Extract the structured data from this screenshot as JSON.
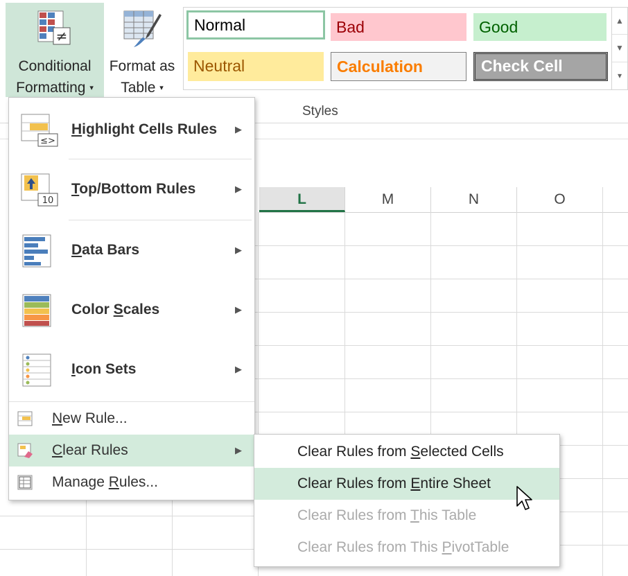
{
  "ribbon": {
    "conditional_formatting": {
      "line1": "Conditional",
      "line2": "Formatting",
      "arrow": "▾"
    },
    "format_as_table": {
      "line1": "Format as",
      "line2": "Table",
      "arrow": "▾"
    },
    "styles": [
      {
        "label": "Normal"
      },
      {
        "label": "Bad"
      },
      {
        "label": "Good"
      },
      {
        "label": "Neutral"
      },
      {
        "label": "Calculation"
      },
      {
        "label": "Check Cell"
      }
    ],
    "styles_group_label": "Styles",
    "scroll_up": "▲",
    "scroll_down": "▼",
    "scroll_more": "▾"
  },
  "sheet": {
    "columns": [
      "L",
      "M",
      "N",
      "O"
    ]
  },
  "menu": {
    "highlight_cells_rules": {
      "pre": "",
      "u": "H",
      "post": "ighlight Cells Rules"
    },
    "top_bottom_rules": {
      "pre": "",
      "u": "T",
      "post": "op/Bottom Rules"
    },
    "data_bars": {
      "pre": "",
      "u": "D",
      "post": "ata Bars"
    },
    "color_scales": {
      "pre": "Color ",
      "u": "S",
      "post": "cales"
    },
    "icon_sets": {
      "pre": "",
      "u": "I",
      "post": "con Sets"
    },
    "new_rule": {
      "pre": "",
      "u": "N",
      "post": "ew Rule..."
    },
    "clear_rules": {
      "pre": "",
      "u": "C",
      "post": "lear Rules"
    },
    "manage_rules": {
      "pre": "Manage ",
      "u": "R",
      "post": "ules..."
    },
    "submenu_arrow": "▶",
    "icons": {
      "highlight": "highlight-cells-icon",
      "top_bottom": "top-bottom-icon",
      "data_bars": "data-bars-icon",
      "color_scales": "color-scales-icon",
      "icon_sets": "icon-sets-icon",
      "new_rule": "new-rule-icon",
      "clear_rules": "clear-rules-icon",
      "manage_rules": "manage-rules-icon"
    },
    "highlight_icon_text": "≤>",
    "top_bottom_icon_text": "10",
    "cf_icon_text": "≠"
  },
  "submenu": {
    "items": [
      {
        "pre": "Clear Rules from ",
        "u": "S",
        "post": "elected Cells",
        "enabled": true
      },
      {
        "pre": "Clear Rules from ",
        "u": "E",
        "post": "ntire Sheet",
        "enabled": true
      },
      {
        "pre": "Clear Rules from ",
        "u": "T",
        "post": "his Table",
        "enabled": false
      },
      {
        "pre": "Clear Rules from This ",
        "u": "P",
        "post": "ivotTable",
        "enabled": false
      }
    ]
  },
  "colors": {
    "accent_green": "#217346",
    "highlight": "#d3ebdc",
    "normal_border": "#8cc6a4",
    "bad_bg": "#ffc7ce",
    "bad_fg": "#9c0006",
    "good_bg": "#c6efce",
    "good_fg": "#006100",
    "neutral_bg": "#ffeb9c",
    "neutral_fg": "#9c5700",
    "calc_bg": "#f2f2f2",
    "calc_fg": "#fa7d00",
    "check_bg": "#a5a5a5"
  }
}
